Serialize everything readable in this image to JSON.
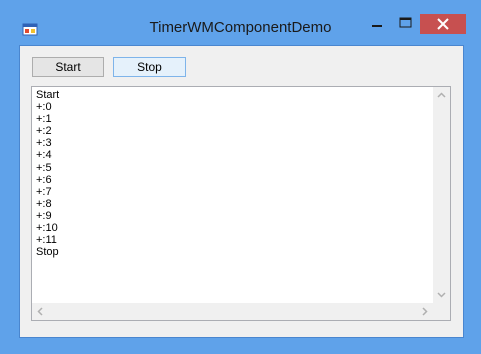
{
  "window": {
    "title": "TimerWMComponentDemo",
    "frame_color": "#5fa2ea",
    "close_color": "#c75050",
    "icons": [
      "app-icon",
      "minimize-icon",
      "maximize-icon",
      "close-icon"
    ]
  },
  "toolbar": {
    "start_label": "Start",
    "stop_label": "Stop"
  },
  "log": {
    "lines": [
      "Start",
      "+:0",
      "+:1",
      "+:2",
      "+:3",
      "+:4",
      "+:5",
      "+:6",
      "+:7",
      "+:8",
      "+:9",
      "+:10",
      "+:11",
      "Stop"
    ]
  }
}
